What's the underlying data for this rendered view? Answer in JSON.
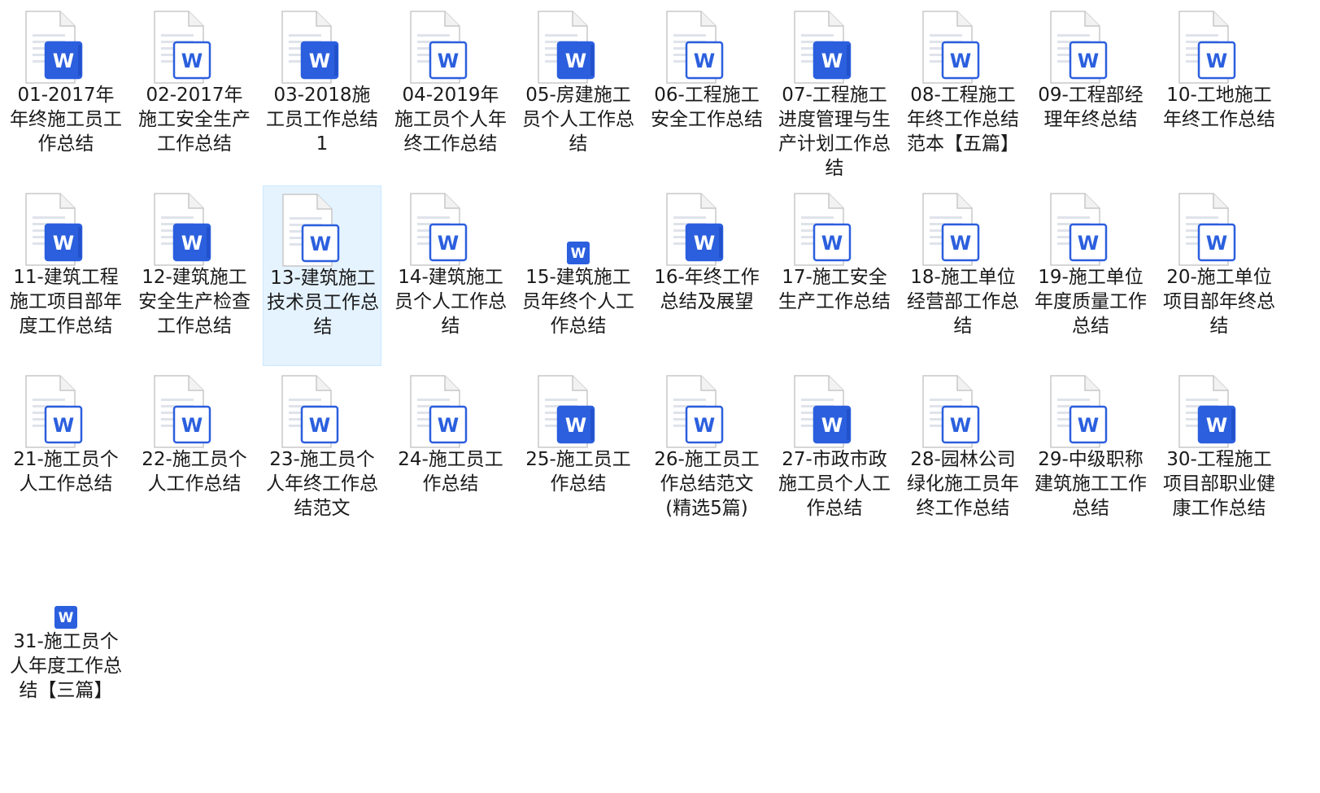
{
  "folder": {
    "view": "large-icons",
    "selected_index": 12,
    "files": [
      {
        "name": "01-2017年年终施工员工作总结",
        "icon": "word-document-icon",
        "style": "dark"
      },
      {
        "name": "02-2017年施工安全生产工作总结",
        "icon": "word-document-icon",
        "style": "light"
      },
      {
        "name": "03-2018施工员工作总结1",
        "icon": "word-document-icon",
        "style": "dark"
      },
      {
        "name": "04-2019年施工员个人年终工作总结",
        "icon": "word-document-icon",
        "style": "light"
      },
      {
        "name": "05-房建施工员个人工作总结",
        "icon": "word-document-icon",
        "style": "dark"
      },
      {
        "name": "06-工程施工安全工作总结",
        "icon": "word-document-icon",
        "style": "light"
      },
      {
        "name": "07-工程施工进度管理与生产计划工作总结",
        "icon": "word-document-icon",
        "style": "dark"
      },
      {
        "name": "08-工程施工年终工作总结范本【五篇】",
        "icon": "word-document-icon",
        "style": "light"
      },
      {
        "name": "09-工程部经理年终总结",
        "icon": "word-document-icon",
        "style": "light"
      },
      {
        "name": "10-工地施工年终工作总结",
        "icon": "word-document-icon",
        "style": "light"
      },
      {
        "name": "11-建筑工程施工项目部年度工作总结",
        "icon": "word-document-icon",
        "style": "dark"
      },
      {
        "name": "12-建筑施工安全生产检查工作总结",
        "icon": "word-document-icon",
        "style": "dark"
      },
      {
        "name": "13-建筑施工技术员工作总结",
        "icon": "word-document-icon",
        "style": "light"
      },
      {
        "name": "14-建筑施工员个人工作总结",
        "icon": "word-document-icon",
        "style": "light"
      },
      {
        "name": "15-建筑施工员年终个人工作总结",
        "icon": "word-app-icon",
        "style": "small"
      },
      {
        "name": "16-年终工作总结及展望",
        "icon": "word-document-icon",
        "style": "dark"
      },
      {
        "name": "17-施工安全生产工作总结",
        "icon": "word-document-icon",
        "style": "light"
      },
      {
        "name": "18-施工单位经营部工作总结",
        "icon": "word-document-icon",
        "style": "light"
      },
      {
        "name": "19-施工单位年度质量工作总结",
        "icon": "word-document-icon",
        "style": "light"
      },
      {
        "name": "20-施工单位项目部年终总结",
        "icon": "word-document-icon",
        "style": "light"
      },
      {
        "name": "21-施工员个人工作总结",
        "icon": "word-document-icon",
        "style": "light"
      },
      {
        "name": "22-施工员个人工作总结",
        "icon": "word-document-icon",
        "style": "light"
      },
      {
        "name": "23-施工员个人年终工作总结范文",
        "icon": "word-document-icon",
        "style": "light"
      },
      {
        "name": "24-施工员工作总结",
        "icon": "word-document-icon",
        "style": "light"
      },
      {
        "name": "25-施工员工作总结",
        "icon": "word-document-icon",
        "style": "dark"
      },
      {
        "name": "26-施工员工作总结范文(精选5篇)",
        "icon": "word-document-icon",
        "style": "light"
      },
      {
        "name": "27-市政市政施工员个人工作总结",
        "icon": "word-document-icon",
        "style": "dark"
      },
      {
        "name": "28-园林公司绿化施工员年终工作总结",
        "icon": "word-document-icon",
        "style": "light"
      },
      {
        "name": "29-中级职称建筑施工工作总结",
        "icon": "word-document-icon",
        "style": "light"
      },
      {
        "name": "30-工程施工项目部职业健康工作总结",
        "icon": "word-document-icon",
        "style": "dark"
      },
      {
        "name": "31-施工员个人年度工作总结【三篇】",
        "icon": "word-app-icon",
        "style": "small"
      }
    ]
  },
  "colors": {
    "word_blue": "#2b5fde",
    "word_blue_dark": "#1d4fd8",
    "selection_bg": "#e5f3ff",
    "selection_border": "#cce8ff",
    "label_text": "#1a1a1a"
  }
}
